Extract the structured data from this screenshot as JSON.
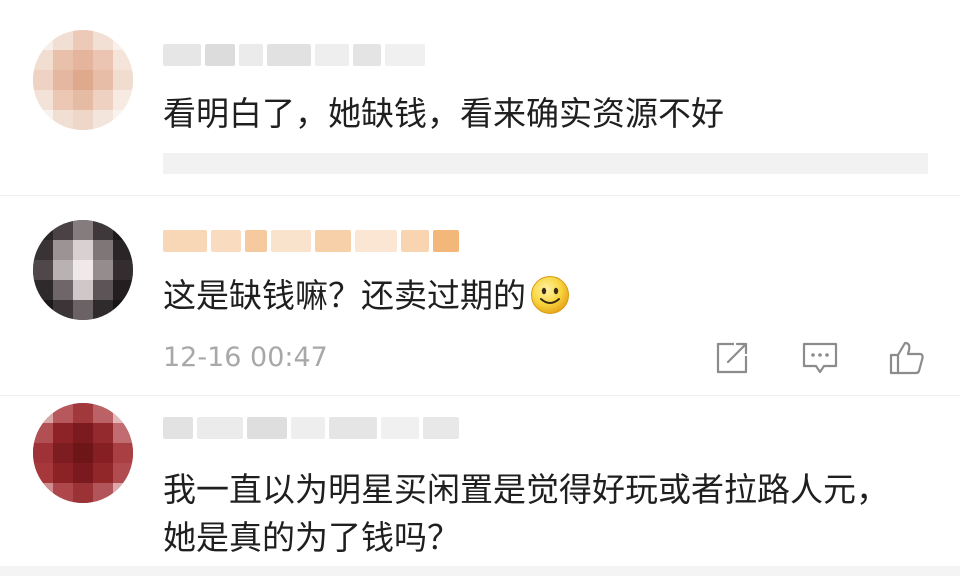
{
  "comments": [
    {
      "text": "看明白了，她缺钱，看来确实资源不好",
      "avatar_icon": "blurred-avatar",
      "avatar_colors": [
        "#f3e3d8",
        "#f0d2c2",
        "#e8c4b0",
        "#f5dccf",
        "#f2e6dd"
      ]
    },
    {
      "text": "这是缺钱嘛？还卖过期的",
      "emoji": "smiley-icon",
      "timestamp": "12-16 00:47",
      "avatar_icon": "blurred-avatar",
      "avatar_colors": [
        "#3a3335",
        "#6d6567",
        "#b6b0b1",
        "#252122",
        "#8c8486"
      ]
    },
    {
      "text_line1": "我一直以为明星买闲置是觉得好玩或者拉路人元，",
      "text_line2": "她是真的为了钱吗？",
      "avatar_icon": "blurred-avatar",
      "avatar_colors": [
        "#8b2d2f",
        "#a9474b",
        "#c98e90",
        "#7a1f22",
        "#b76266"
      ]
    }
  ],
  "actions": [
    "share-icon",
    "comment-icon",
    "like-icon"
  ],
  "colors": {
    "text": "#1f1f1f",
    "meta": "#a8a8a8",
    "icon": "#8c8c8c",
    "name_blur_gray": "#e3e3e3",
    "name_blur_orange": "#f6c79b",
    "smiley": "#f7d54a"
  }
}
